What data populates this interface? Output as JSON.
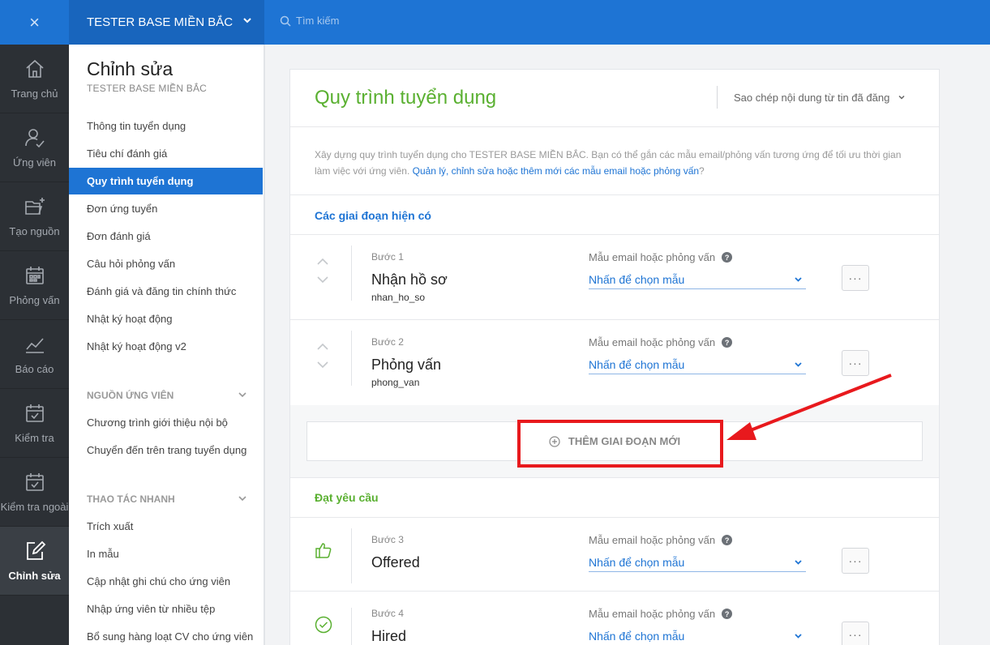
{
  "topbar": {
    "close_icon": "×",
    "company": "TESTER BASE MIỀN BẮC",
    "search_placeholder": "Tìm kiếm"
  },
  "rail": [
    {
      "label": "Trang chủ",
      "icon": "home-icon"
    },
    {
      "label": "Ứng viên",
      "icon": "candidate-icon"
    },
    {
      "label": "Tạo nguồn",
      "icon": "folder-plus-icon"
    },
    {
      "label": "Phỏng vấn",
      "icon": "calendar-grid-icon"
    },
    {
      "label": "Báo cáo",
      "icon": "chart-line-icon"
    },
    {
      "label": "Kiểm tra",
      "icon": "calendar-check-icon"
    },
    {
      "label": "Kiểm tra ngoài",
      "icon": "calendar-check-icon"
    },
    {
      "label": "Chỉnh sửa",
      "icon": "edit-icon",
      "active": true
    }
  ],
  "sidebar": {
    "title": "Chỉnh sửa",
    "subtitle": "TESTER BASE MIỀN BẮC",
    "links": [
      "Thông tin tuyển dụng",
      "Tiêu chí đánh giá",
      "Quy trình tuyển dụng",
      "Đơn ứng tuyển",
      "Đơn đánh giá",
      "Câu hỏi phỏng vấn",
      "Đánh giá và đăng tin chính thức",
      "Nhật ký hoạt động",
      "Nhật ký hoạt động v2"
    ],
    "section_sources": "NGUỒN ỨNG VIÊN",
    "source_links": [
      "Chương trình giới thiệu nội bộ",
      "Chuyển đến trên trang tuyển dụng"
    ],
    "section_quick": "THAO TÁC NHANH",
    "quick_links": [
      "Trích xuất",
      "In mẫu",
      "Cập nhật ghi chú cho ứng viên",
      "Nhập ứng viên từ nhiều tệp",
      "Bổ sung hàng loạt CV cho ứng viên"
    ]
  },
  "main": {
    "title": "Quy trình tuyển dụng",
    "copy_label": "Sao chép nội dung từ tin đã đăng",
    "description": "Xây dựng quy trình tuyển dụng cho TESTER BASE MIỀN BẮC. Bạn có thể gắn các mẫu email/phỏng vấn tương ứng để tối ưu thời gian làm việc với ứng viên.",
    "description_link": "Quản lý, chỉnh sửa hoặc thêm mới các mẫu email hoặc phỏng vấn",
    "description_end": "?",
    "section_current": "Các giai đoạn hiện có",
    "section_pass": "Đạt yêu cầu",
    "template_label": "Mẫu email hoặc phỏng vấn",
    "template_placeholder": "Nhấn để chọn mẫu",
    "more_label": "···",
    "add_stage": "THÊM GIAI ĐOẠN MỚI",
    "stages": [
      {
        "step": "Bước 1",
        "name": "Nhận hồ sơ",
        "code": "nhan_ho_so"
      },
      {
        "step": "Bước 2",
        "name": "Phỏng vấn",
        "code": "phong_van"
      },
      {
        "step": "Bước 3",
        "name": "Offered",
        "code": ""
      },
      {
        "step": "Bước 4",
        "name": "Hired",
        "code": ""
      }
    ]
  },
  "colors": {
    "brand_blue": "#1e74d4",
    "accent_green": "#5ab031",
    "highlight_red": "#e8191d"
  }
}
